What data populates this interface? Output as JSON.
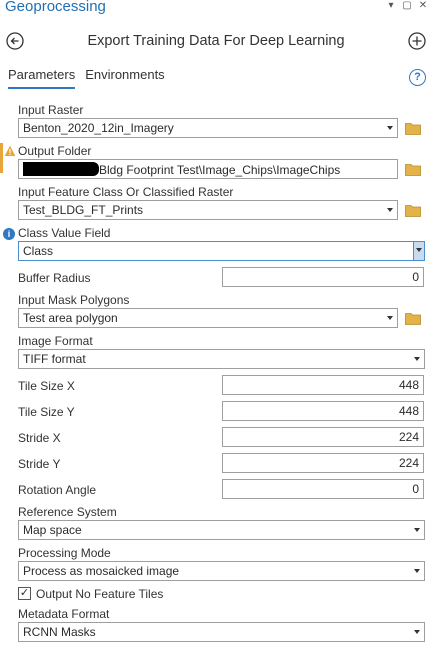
{
  "pane": {
    "title": "Geoprocessing",
    "controls": [
      "▾",
      "▢",
      "✕"
    ]
  },
  "tool": {
    "title": "Export Training Data For Deep Learning"
  },
  "tabs": [
    {
      "label": "Parameters",
      "active": true
    },
    {
      "label": "Environments",
      "active": false
    }
  ],
  "help": "?",
  "params": {
    "input_raster": {
      "label": "Input Raster",
      "value": "Benton_2020_12in_Imagery"
    },
    "output_folder": {
      "label": "Output Folder",
      "value": "Bldg Footprint Test\\Image_Chips\\ImageChips"
    },
    "input_feature_class": {
      "label": "Input Feature Class Or Classified Raster",
      "value": "Test_BLDG_FT_Prints"
    },
    "class_value_field": {
      "label": "Class Value Field",
      "value": "Class"
    },
    "buffer_radius": {
      "label": "Buffer Radius",
      "value": "0"
    },
    "input_mask": {
      "label": "Input Mask Polygons",
      "value": "Test area polygon"
    },
    "image_format": {
      "label": "Image Format",
      "value": "TIFF format"
    },
    "tile_size_x": {
      "label": "Tile Size X",
      "value": "448"
    },
    "tile_size_y": {
      "label": "Tile Size Y",
      "value": "448"
    },
    "stride_x": {
      "label": "Stride X",
      "value": "224"
    },
    "stride_y": {
      "label": "Stride Y",
      "value": "224"
    },
    "rotation_angle": {
      "label": "Rotation Angle",
      "value": "0"
    },
    "reference_system": {
      "label": "Reference System",
      "value": "Map space"
    },
    "processing_mode": {
      "label": "Processing Mode",
      "value": "Process as mosaicked image"
    },
    "output_no_feature_tiles": {
      "label": "Output No Feature Tiles",
      "checked": true
    },
    "metadata_format": {
      "label": "Metadata Format",
      "value": "RCNN Masks"
    }
  },
  "colors": {
    "accent": "#2f79c4",
    "warning": "#e8a63a",
    "folder": "#e3b34a"
  },
  "icons": {
    "back": "arrow-left-circle",
    "add": "plus-circle",
    "folder": "folder",
    "warning": "warning-triangle",
    "info": "info-circle"
  }
}
